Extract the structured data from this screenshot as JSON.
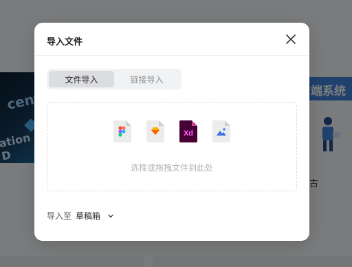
{
  "background": {
    "left_image_line1": "cent",
    "left_image_line2": "ation D",
    "right_banner": "端系统",
    "right_text": "古"
  },
  "modal": {
    "title": "导入文件",
    "tabs": [
      {
        "label": "文件导入",
        "active": true
      },
      {
        "label": "链接导入",
        "active": false
      }
    ],
    "file_types": [
      {
        "icon": "figma-file-icon"
      },
      {
        "icon": "sketch-file-icon"
      },
      {
        "icon": "xd-file-icon",
        "label": "Xd"
      },
      {
        "icon": "image-file-icon"
      }
    ],
    "drop_text": "选择或拖拽文件到此处",
    "import_to_label": "导入至",
    "import_target": "草稿箱"
  },
  "colors": {
    "xd_bg": "#470137",
    "xd_text": "#ff61f6",
    "sketch": "#f7b500",
    "image": "#3b6fe0"
  }
}
